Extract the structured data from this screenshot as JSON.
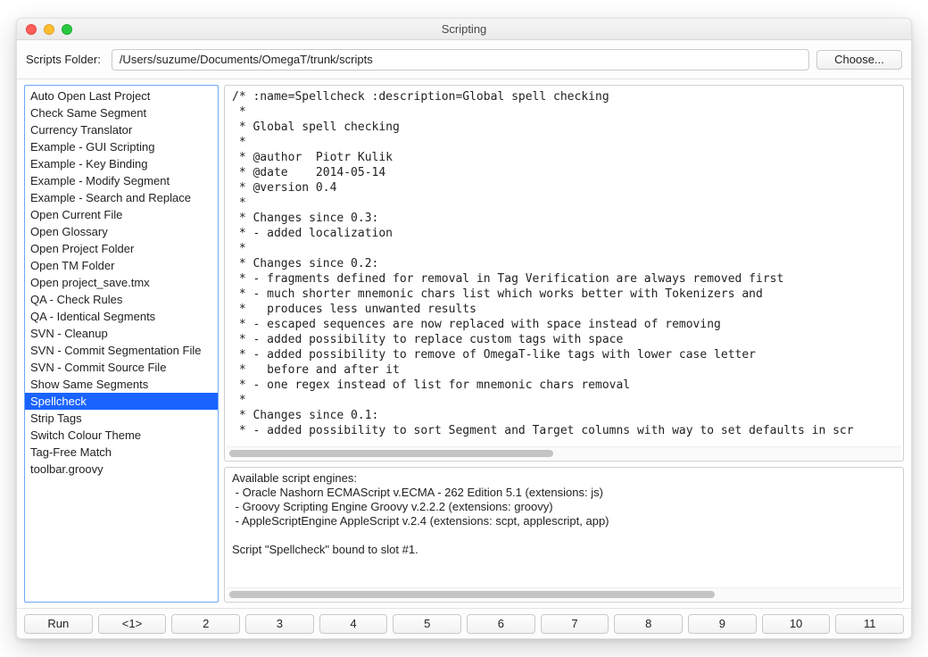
{
  "window": {
    "title": "Scripting"
  },
  "toolbar": {
    "label": "Scripts Folder:",
    "path": "/Users/suzume/Documents/OmegaT/trunk/scripts",
    "choose": "Choose..."
  },
  "sidebar": {
    "selected_index": 15,
    "items": [
      "Auto Open Last Project",
      "Check Same Segment",
      "Currency Translator",
      "Example - GUI Scripting",
      "Example - Key Binding",
      "Example - Modify Segment",
      "Example - Search and Replace",
      "Open Current File",
      "Open Glossary",
      "Open Project Folder",
      "Open TM Folder",
      "Open project_save.tmx",
      "QA - Check Rules",
      "QA - Identical Segments",
      "SVN - Cleanup",
      "SVN - Commit Segmentation File",
      "SVN - Commit Source File",
      "Show Same Segments",
      "Spellcheck",
      "Strip Tags",
      "Switch Colour Theme",
      "Tag-Free Match",
      "toolbar.groovy"
    ]
  },
  "editor": {
    "lines": [
      "/* :name=Spellcheck :description=Global spell checking",
      " *",
      " * Global spell checking",
      " *",
      " * @author  Piotr Kulik",
      " * @date    2014-05-14",
      " * @version 0.4",
      " *",
      " * Changes since 0.3:",
      " * - added localization",
      " *",
      " * Changes since 0.2:",
      " * - fragments defined for removal in Tag Verification are always removed first",
      " * - much shorter mnemonic chars list which works better with Tokenizers and",
      " *   produces less unwanted results",
      " * - escaped sequences are now replaced with space instead of removing",
      " * - added possibility to replace custom tags with space",
      " * - added possibility to remove of OmegaT-like tags with lower case letter",
      " *   before and after it",
      " * - one regex instead of list for mnemonic chars removal",
      " *",
      " * Changes since 0.1:",
      " * - added possibility to sort Segment and Target columns with way to set defaults in scr"
    ]
  },
  "console": {
    "lines": [
      "Available script engines:",
      " - Oracle Nashorn ECMAScript v.ECMA - 262 Edition 5.1 (extensions: js)",
      " - Groovy Scripting Engine Groovy v.2.2.2 (extensions: groovy)",
      " - AppleScriptEngine AppleScript v.2.4 (extensions: scpt, applescript, app)",
      "",
      "Script \"Spellcheck\" bound to slot #1."
    ]
  },
  "footer": {
    "run": "Run",
    "slots": [
      "<1>",
      "2",
      "3",
      "4",
      "5",
      "6",
      "7",
      "8",
      "9",
      "10",
      "11"
    ]
  },
  "sidebar_correction": {
    "selected_index": 18
  }
}
